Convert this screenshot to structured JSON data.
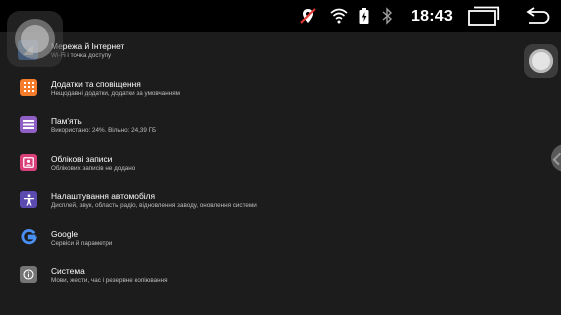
{
  "status_bar": {
    "time": "18:43",
    "icons": [
      "no-location-icon",
      "wifi-icon",
      "battery-icon",
      "bluetooth-icon",
      "recent-apps-icon",
      "back-icon"
    ],
    "colors": {
      "background": "#000000",
      "no_location_slash": "#e53935",
      "foreground": "#ffffff"
    }
  },
  "settings": {
    "items": [
      {
        "icon": "network-icon",
        "color": "#4a7dc0",
        "title": "Мережа й Інтернет",
        "subtitle": "Wi-Fi і точка доступу"
      },
      {
        "icon": "apps-icon",
        "color": "#f57c2a",
        "title": "Додатки та сповіщення",
        "subtitle": "Нещодавні додатки, додатки за умовчанням"
      },
      {
        "icon": "storage-icon",
        "color": "#8e5fc4",
        "title": "Пам'ять",
        "subtitle": "Використано: 24%. Вільно: 24,39 ГБ"
      },
      {
        "icon": "accounts-icon",
        "color": "#d9407a",
        "title": "Облікові записи",
        "subtitle": "Облікових записів не додано"
      },
      {
        "icon": "car-settings-icon",
        "color": "#5b4ab0",
        "title": "Налаштування автомобіля",
        "subtitle": "Дисплей, звук, область радіо, відновлення заводу, оновлення системи"
      },
      {
        "icon": "google-icon",
        "color": "#3b78e7",
        "title": "Google",
        "subtitle": "Сервіси й параметри"
      },
      {
        "icon": "system-icon",
        "color": "#757575",
        "title": "Система",
        "subtitle": "Мови, жести, час і резервне копіювання"
      }
    ]
  },
  "theme": {
    "background": "#1c1c1c",
    "title_color": "#ffffff",
    "subtitle_color": "#bdbdbd"
  }
}
